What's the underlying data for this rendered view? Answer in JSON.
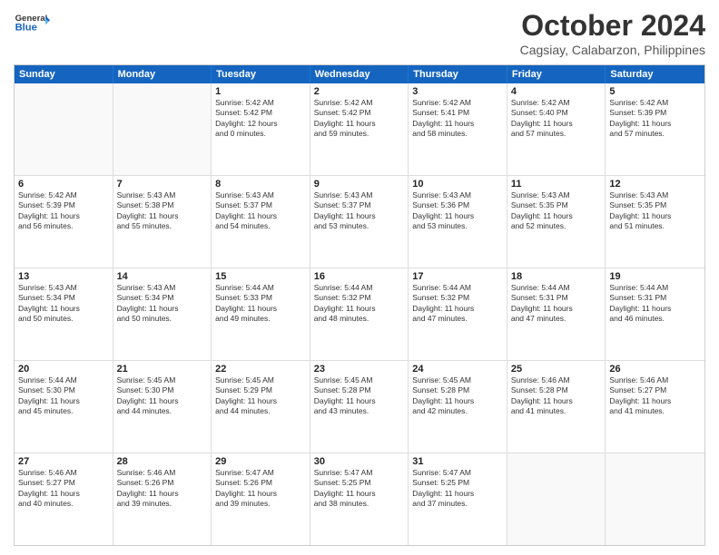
{
  "header": {
    "logo": {
      "line1": "General",
      "line2": "Blue"
    },
    "title": "October 2024",
    "subtitle": "Cagsiay, Calabarzon, Philippines"
  },
  "calendar": {
    "days_of_week": [
      "Sunday",
      "Monday",
      "Tuesday",
      "Wednesday",
      "Thursday",
      "Friday",
      "Saturday"
    ],
    "weeks": [
      [
        {
          "day": "",
          "info": ""
        },
        {
          "day": "",
          "info": ""
        },
        {
          "day": "1",
          "info": "Sunrise: 5:42 AM\nSunset: 5:42 PM\nDaylight: 12 hours\nand 0 minutes."
        },
        {
          "day": "2",
          "info": "Sunrise: 5:42 AM\nSunset: 5:42 PM\nDaylight: 11 hours\nand 59 minutes."
        },
        {
          "day": "3",
          "info": "Sunrise: 5:42 AM\nSunset: 5:41 PM\nDaylight: 11 hours\nand 58 minutes."
        },
        {
          "day": "4",
          "info": "Sunrise: 5:42 AM\nSunset: 5:40 PM\nDaylight: 11 hours\nand 57 minutes."
        },
        {
          "day": "5",
          "info": "Sunrise: 5:42 AM\nSunset: 5:39 PM\nDaylight: 11 hours\nand 57 minutes."
        }
      ],
      [
        {
          "day": "6",
          "info": "Sunrise: 5:42 AM\nSunset: 5:39 PM\nDaylight: 11 hours\nand 56 minutes."
        },
        {
          "day": "7",
          "info": "Sunrise: 5:43 AM\nSunset: 5:38 PM\nDaylight: 11 hours\nand 55 minutes."
        },
        {
          "day": "8",
          "info": "Sunrise: 5:43 AM\nSunset: 5:37 PM\nDaylight: 11 hours\nand 54 minutes."
        },
        {
          "day": "9",
          "info": "Sunrise: 5:43 AM\nSunset: 5:37 PM\nDaylight: 11 hours\nand 53 minutes."
        },
        {
          "day": "10",
          "info": "Sunrise: 5:43 AM\nSunset: 5:36 PM\nDaylight: 11 hours\nand 53 minutes."
        },
        {
          "day": "11",
          "info": "Sunrise: 5:43 AM\nSunset: 5:35 PM\nDaylight: 11 hours\nand 52 minutes."
        },
        {
          "day": "12",
          "info": "Sunrise: 5:43 AM\nSunset: 5:35 PM\nDaylight: 11 hours\nand 51 minutes."
        }
      ],
      [
        {
          "day": "13",
          "info": "Sunrise: 5:43 AM\nSunset: 5:34 PM\nDaylight: 11 hours\nand 50 minutes."
        },
        {
          "day": "14",
          "info": "Sunrise: 5:43 AM\nSunset: 5:34 PM\nDaylight: 11 hours\nand 50 minutes."
        },
        {
          "day": "15",
          "info": "Sunrise: 5:44 AM\nSunset: 5:33 PM\nDaylight: 11 hours\nand 49 minutes."
        },
        {
          "day": "16",
          "info": "Sunrise: 5:44 AM\nSunset: 5:32 PM\nDaylight: 11 hours\nand 48 minutes."
        },
        {
          "day": "17",
          "info": "Sunrise: 5:44 AM\nSunset: 5:32 PM\nDaylight: 11 hours\nand 47 minutes."
        },
        {
          "day": "18",
          "info": "Sunrise: 5:44 AM\nSunset: 5:31 PM\nDaylight: 11 hours\nand 47 minutes."
        },
        {
          "day": "19",
          "info": "Sunrise: 5:44 AM\nSunset: 5:31 PM\nDaylight: 11 hours\nand 46 minutes."
        }
      ],
      [
        {
          "day": "20",
          "info": "Sunrise: 5:44 AM\nSunset: 5:30 PM\nDaylight: 11 hours\nand 45 minutes."
        },
        {
          "day": "21",
          "info": "Sunrise: 5:45 AM\nSunset: 5:30 PM\nDaylight: 11 hours\nand 44 minutes."
        },
        {
          "day": "22",
          "info": "Sunrise: 5:45 AM\nSunset: 5:29 PM\nDaylight: 11 hours\nand 44 minutes."
        },
        {
          "day": "23",
          "info": "Sunrise: 5:45 AM\nSunset: 5:28 PM\nDaylight: 11 hours\nand 43 minutes."
        },
        {
          "day": "24",
          "info": "Sunrise: 5:45 AM\nSunset: 5:28 PM\nDaylight: 11 hours\nand 42 minutes."
        },
        {
          "day": "25",
          "info": "Sunrise: 5:46 AM\nSunset: 5:28 PM\nDaylight: 11 hours\nand 41 minutes."
        },
        {
          "day": "26",
          "info": "Sunrise: 5:46 AM\nSunset: 5:27 PM\nDaylight: 11 hours\nand 41 minutes."
        }
      ],
      [
        {
          "day": "27",
          "info": "Sunrise: 5:46 AM\nSunset: 5:27 PM\nDaylight: 11 hours\nand 40 minutes."
        },
        {
          "day": "28",
          "info": "Sunrise: 5:46 AM\nSunset: 5:26 PM\nDaylight: 11 hours\nand 39 minutes."
        },
        {
          "day": "29",
          "info": "Sunrise: 5:47 AM\nSunset: 5:26 PM\nDaylight: 11 hours\nand 39 minutes."
        },
        {
          "day": "30",
          "info": "Sunrise: 5:47 AM\nSunset: 5:25 PM\nDaylight: 11 hours\nand 38 minutes."
        },
        {
          "day": "31",
          "info": "Sunrise: 5:47 AM\nSunset: 5:25 PM\nDaylight: 11 hours\nand 37 minutes."
        },
        {
          "day": "",
          "info": ""
        },
        {
          "day": "",
          "info": ""
        }
      ]
    ]
  }
}
